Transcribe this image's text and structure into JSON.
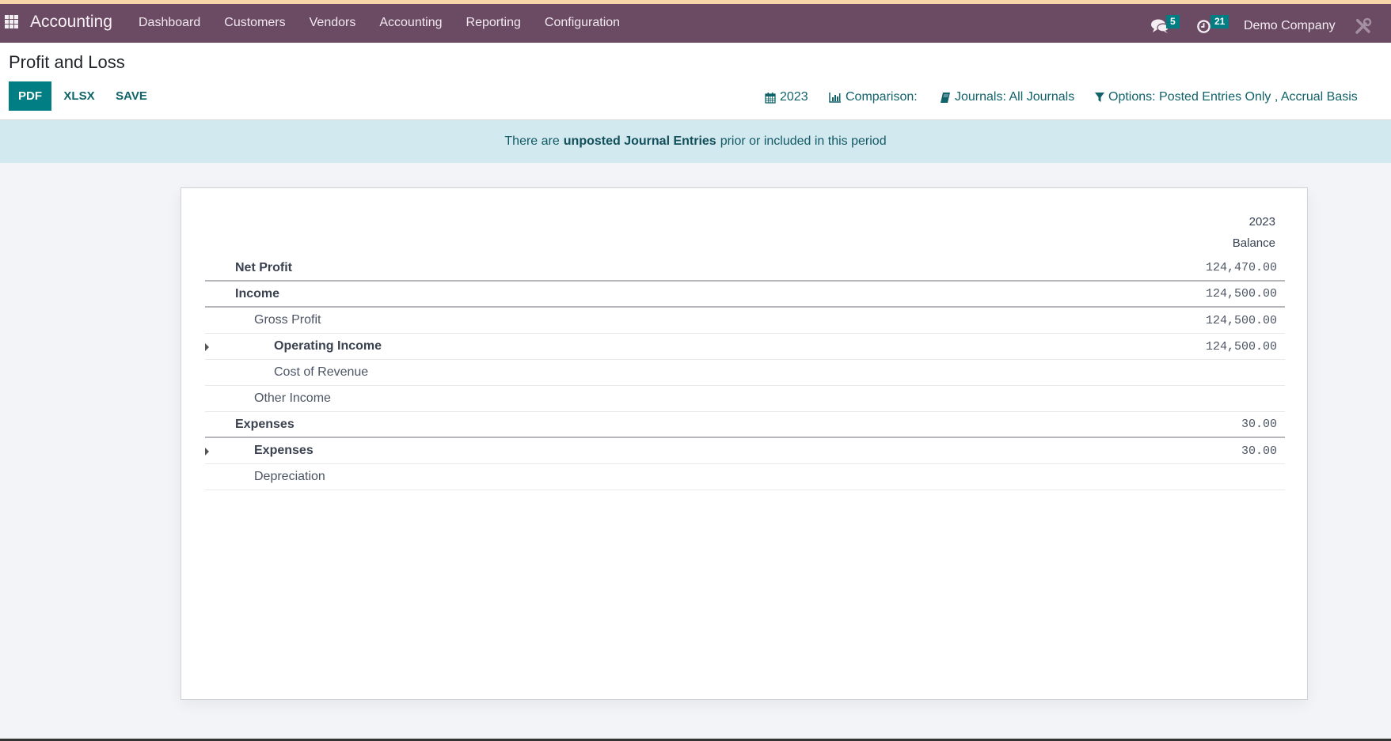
{
  "navbar": {
    "app_name": "Accounting",
    "menu": [
      "Dashboard",
      "Customers",
      "Vendors",
      "Accounting",
      "Reporting",
      "Configuration"
    ],
    "messages_count": "5",
    "activities_count": "21",
    "company": "Demo Company",
    "accent_color": "#6b4a63"
  },
  "page": {
    "title": "Profit and Loss",
    "buttons": {
      "pdf": "PDF",
      "xlsx": "XLSX",
      "save": "SAVE"
    },
    "filters": {
      "date": "2023",
      "comparison": "Comparison:",
      "journals": "Journals: All Journals",
      "options": "Options: Posted Entries Only , Accrual Basis"
    }
  },
  "banner": {
    "prefix": "There are",
    "link": "unposted Journal Entries",
    "suffix": "prior or included in this period"
  },
  "report": {
    "column_period": "2023",
    "column_label": "Balance",
    "rows": [
      {
        "label": "Net Profit",
        "amount": "124,470.00"
      },
      {
        "label": "Income",
        "amount": "124,500.00"
      },
      {
        "label": "Gross Profit",
        "amount": "124,500.00"
      },
      {
        "label": "Operating Income",
        "amount": "124,500.00"
      },
      {
        "label": "Cost of Revenue",
        "amount": ""
      },
      {
        "label": "Other Income",
        "amount": ""
      },
      {
        "label": "Expenses",
        "amount": "30.00"
      },
      {
        "label": "Expenses",
        "amount": "30.00"
      },
      {
        "label": "Depreciation",
        "amount": ""
      }
    ]
  }
}
